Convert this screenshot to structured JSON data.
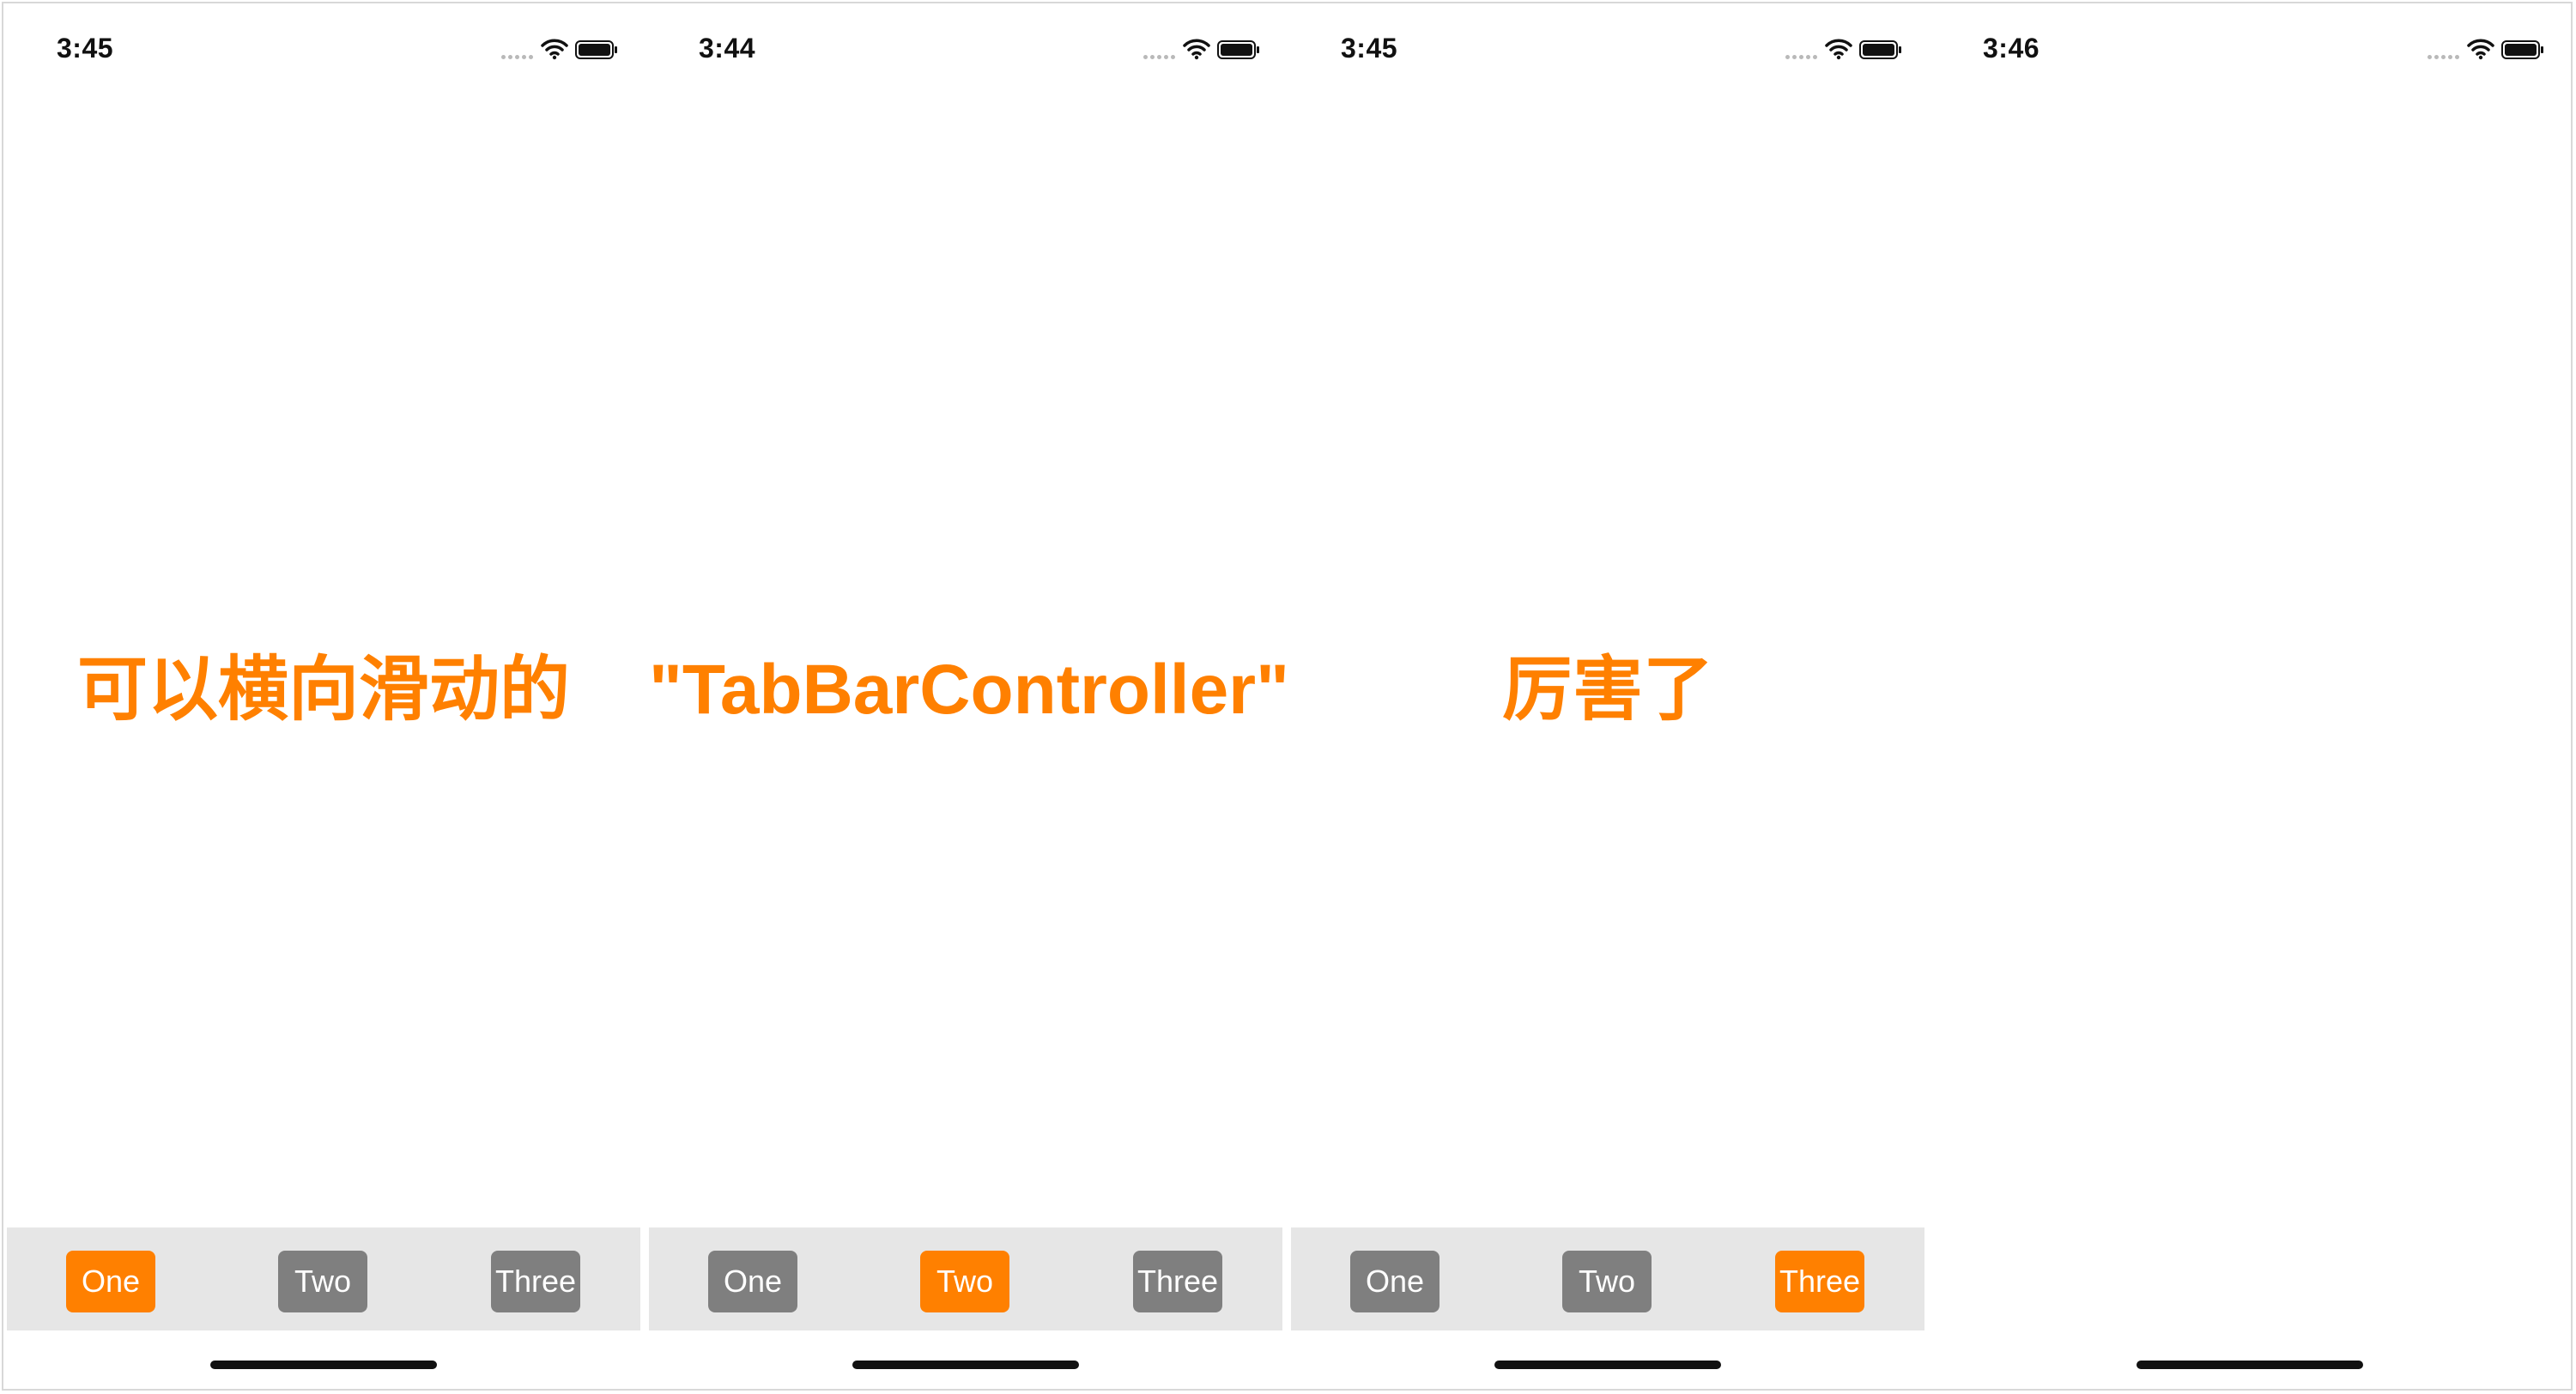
{
  "colors": {
    "accent": "#ff8000",
    "tab_inactive": "#7f7f7f",
    "tab_bar_background": "#e6e6e6",
    "home_indicator": "#111111"
  },
  "icons": [
    "signal-icon",
    "wifi-icon",
    "battery-icon"
  ],
  "screens": [
    {
      "status": {
        "time": "3:45"
      },
      "content": {
        "text": "可以横向滑动的"
      },
      "tab_bar": {
        "visible": true,
        "selected": "One",
        "tabs": [
          {
            "label": "One"
          },
          {
            "label": "Two"
          },
          {
            "label": "Three"
          }
        ]
      }
    },
    {
      "status": {
        "time": "3:44"
      },
      "content": {
        "text": "\"TabBarController\""
      },
      "tab_bar": {
        "visible": true,
        "selected": "Two",
        "tabs": [
          {
            "label": "One"
          },
          {
            "label": "Two"
          },
          {
            "label": "Three"
          }
        ]
      }
    },
    {
      "status": {
        "time": "3:45"
      },
      "content": {
        "text": "厉害了"
      },
      "tab_bar": {
        "visible": true,
        "selected": "Three",
        "tabs": [
          {
            "label": "One"
          },
          {
            "label": "Two"
          },
          {
            "label": "Three"
          }
        ]
      }
    },
    {
      "status": {
        "time": "3:46"
      },
      "content": {
        "text": ""
      },
      "tab_bar": {
        "visible": false
      }
    }
  ]
}
